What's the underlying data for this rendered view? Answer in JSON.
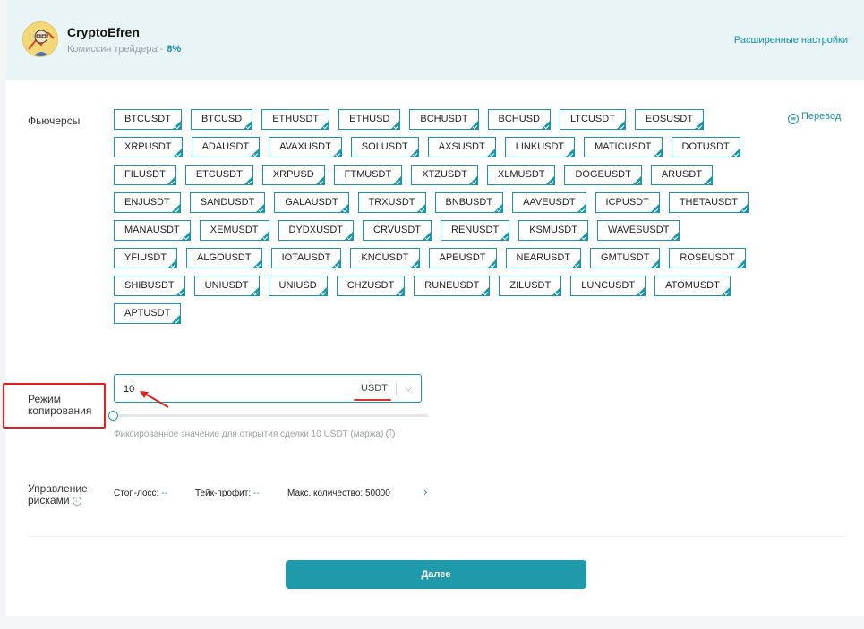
{
  "header": {
    "trader_name": "CryptoEfren",
    "commission_label": "Комиссия трейдера -",
    "commission_value": "8%",
    "advanced_settings": "Расширенные настройки"
  },
  "futures": {
    "label": "Фьючерсы",
    "translate_label": "Перевод",
    "pairs": [
      "BTCUSDT",
      "BTCUSD",
      "ETHUSDT",
      "ETHUSD",
      "BCHUSDT",
      "BCHUSD",
      "LTCUSDT",
      "EOSUSDT",
      "XRPUSDT",
      "ADAUSDT",
      "AVAXUSDT",
      "SOLUSDT",
      "AXSUSDT",
      "LINKUSDT",
      "MATICUSDT",
      "DOTUSDT",
      "FILUSDT",
      "ETCUSDT",
      "XRPUSD",
      "FTMUSDT",
      "XTZUSDT",
      "XLMUSDT",
      "DOGEUSDT",
      "ARUSDT",
      "ENJUSDT",
      "SANDUSDT",
      "GALAUSDT",
      "TRXUSDT",
      "BNBUSDT",
      "AAVEUSDT",
      "ICPUSDT",
      "THETAUSDT",
      "MANAUSDT",
      "XEMUSDT",
      "DYDXUSDT",
      "CRVUSDT",
      "RENUSDT",
      "KSMUSDT",
      "WAVESUSDT",
      "YFIUSDT",
      "ALGOUSDT",
      "IOTAUSDT",
      "KNCUSDT",
      "APEUSDT",
      "NEARUSDT",
      "GMTUSDT",
      "ROSEUSDT",
      "SHIBUSDT",
      "UNIUSDT",
      "UNIUSD",
      "CHZUSDT",
      "RUNEUSDT",
      "ZILUSDT",
      "LUNCUSDT",
      "ATOMUSDT",
      "APTUSDT"
    ]
  },
  "copy_mode": {
    "label_line1": "Режим",
    "label_line2": "копирования",
    "amount_value": "10",
    "unit": "USDT",
    "hint": "Фиксированное значение для открытия сделки 10 USDT (маржа)",
    "slider_fraction": 0
  },
  "risk": {
    "label_line1": "Управление",
    "label_line2": "рисками",
    "stop_loss_label": "Стоп-лосс:",
    "stop_loss_value": "--",
    "take_profit_label": "Тейк-профит:",
    "take_profit_value": "--",
    "max_qty_label": "Макс. количество:",
    "max_qty_value": "50000"
  },
  "actions": {
    "next": "Далее"
  },
  "colors": {
    "accent": "#1e9aab",
    "header_bg": "#e9f4f6",
    "annotation": "#e02020"
  },
  "icons": {
    "translate": "translate-icon",
    "info": "info-icon",
    "dropdown": "chevron-down-icon",
    "expand": "chevron-right-icon"
  }
}
